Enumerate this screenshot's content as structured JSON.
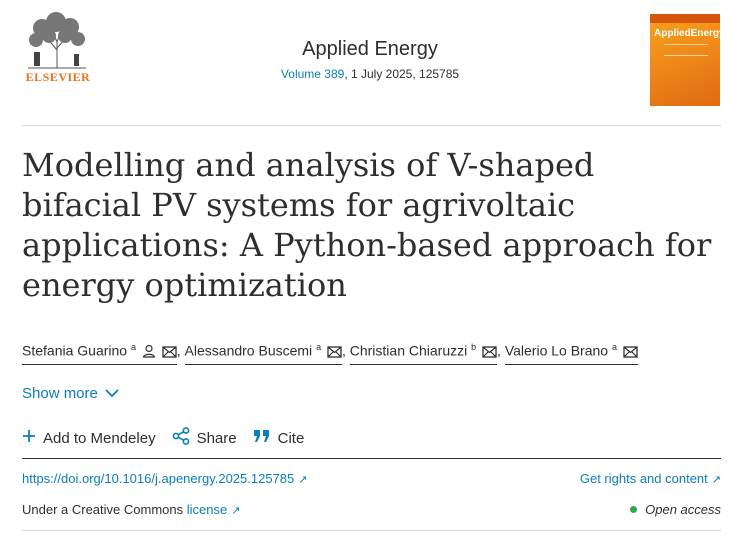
{
  "header": {
    "publisher": "ELSEVIER",
    "journal_title": "Applied Energy",
    "volume_link": "Volume 389",
    "issue_detail": ", 1 July 2025, 125785",
    "cover_title": "AppliedEnergy"
  },
  "article": {
    "title": "Modelling and analysis of V-shaped bifacial PV systems for agrivoltaic applications: A Python-based approach for energy optimization"
  },
  "authors": [
    {
      "name": "Stefania Guarino",
      "affiliation": "a"
    },
    {
      "name": "Alessandro Buscemi",
      "affiliation": "a"
    },
    {
      "name": "Christian Chiaruzzi",
      "affiliation": "b"
    },
    {
      "name": "Valerio Lo Brano",
      "affiliation": "a"
    }
  ],
  "show_more": "Show more",
  "actions": {
    "mendeley": "Add to Mendeley",
    "share": "Share",
    "cite": "Cite"
  },
  "links": {
    "doi": "https://doi.org/10.1016/j.apenergy.2025.125785",
    "rights": "Get rights and content",
    "license_prefix": "Under a Creative Commons ",
    "license": "license",
    "open_access": "Open access"
  },
  "colors": {
    "link": "#0c7dbb",
    "publisher": "#e9711c",
    "open_access_dot": "#2fa84f"
  }
}
